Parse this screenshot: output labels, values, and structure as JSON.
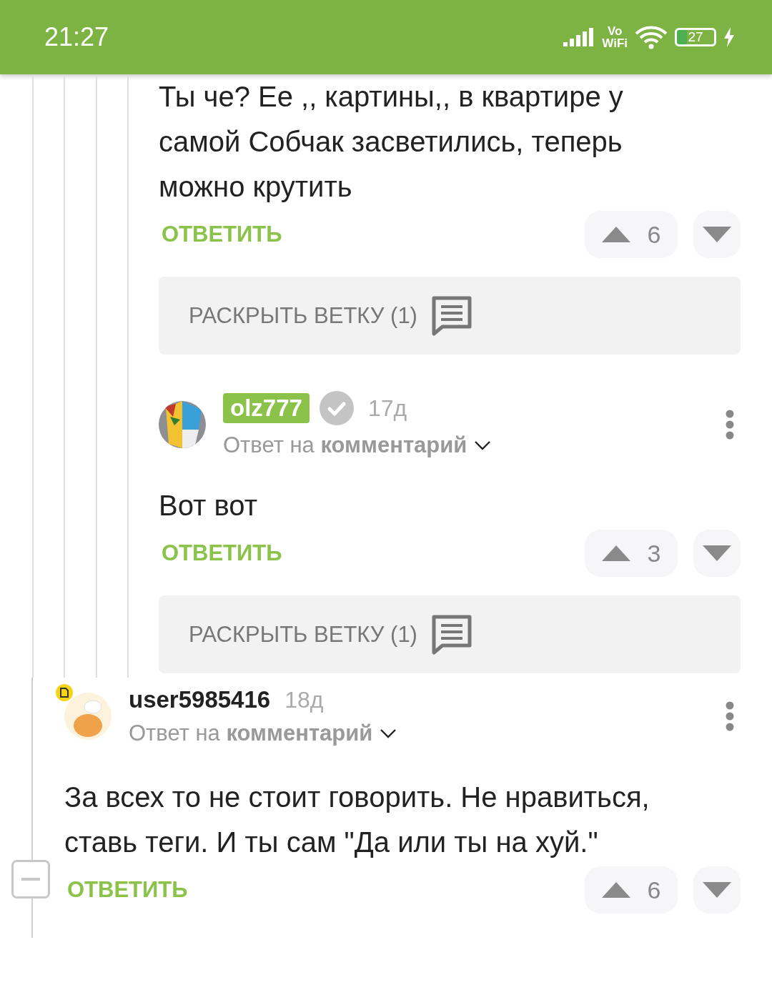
{
  "status_bar": {
    "time": "21:27",
    "network_top": "Vo",
    "network_bottom": "WiFi",
    "battery": "27"
  },
  "nested_comments": [
    {
      "body": "Ты че? Ее ,, картины,, в квартире у самой Собчак засветились, теперь можно крутить",
      "reply_label": "ОТВЕТИТЬ",
      "votes": "6",
      "expand_label": "РАСКРЫТЬ ВЕТКУ (1)"
    },
    {
      "author": "olz777",
      "author_highlighted": true,
      "verified": true,
      "time": "17д",
      "reply_to": "Ответ на **комментарий**",
      "body": "Вот вот",
      "reply_label": "ОТВЕТИТЬ",
      "votes": "3",
      "expand_label": "РАСКРЫТЬ ВЕТКУ (1)"
    }
  ],
  "comment": {
    "author": "user5985416",
    "author_highlighted": false,
    "avatar_badge": true,
    "time": "18д",
    "reply_to": "Ответ на **комментарий**",
    "body": "За всех то не стоит говорить. Не нравиться, ставь теги. И ты сам \"Да или ты на хуй.\"",
    "reply_label": "ОТВЕТИТЬ",
    "votes": "6"
  }
}
